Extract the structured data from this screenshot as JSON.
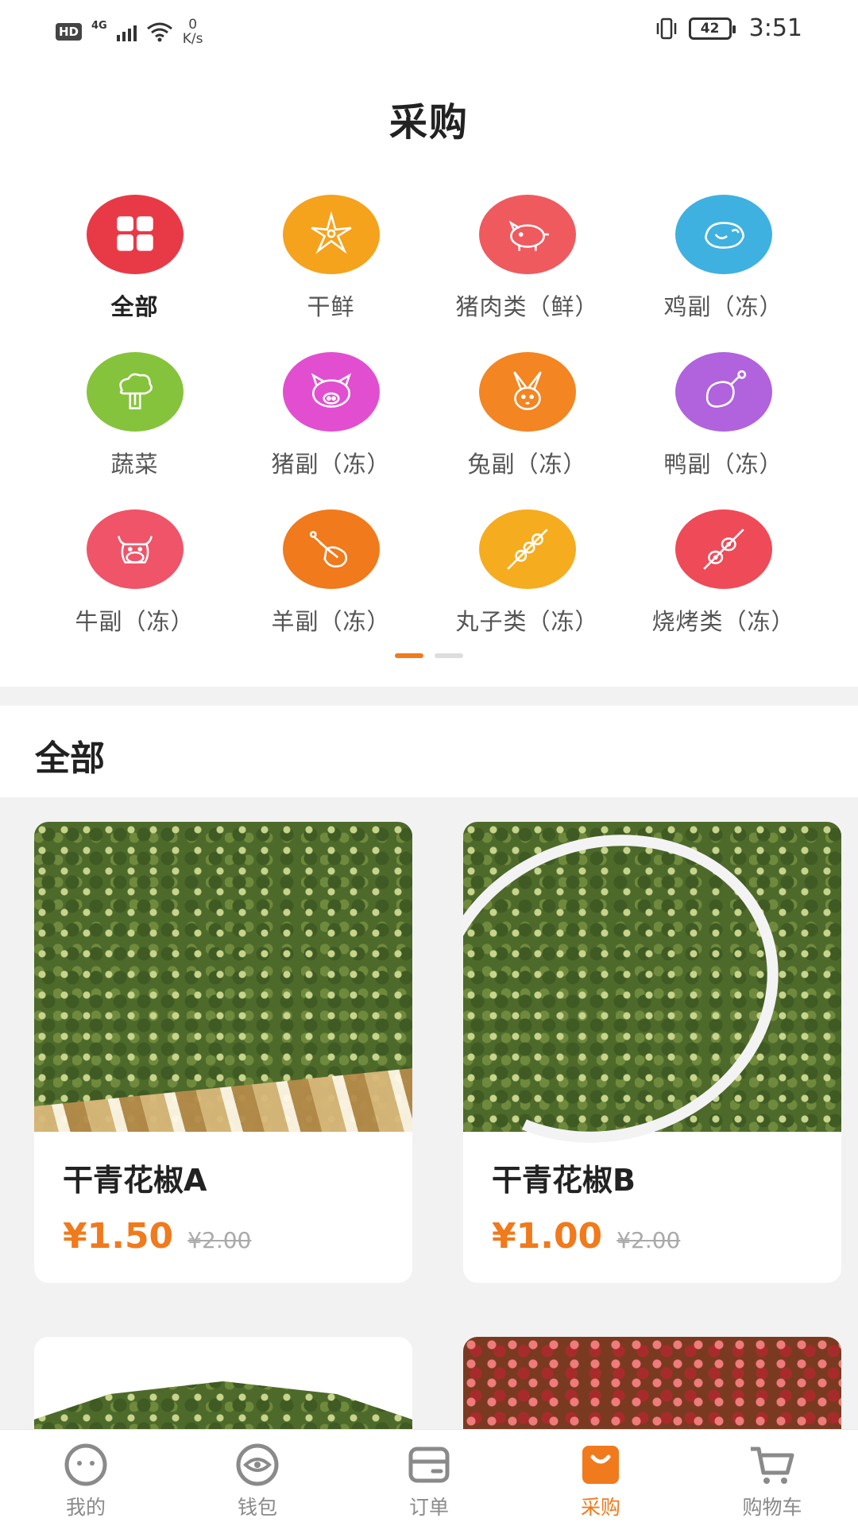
{
  "status_bar": {
    "hd": "HD",
    "network": "4G",
    "speed_value": "0",
    "speed_unit": "K/s",
    "battery": "42",
    "time": "3:51"
  },
  "header": {
    "title": "采购"
  },
  "categories": [
    {
      "label": "全部",
      "icon": "grid-icon",
      "color": "#e83a46"
    },
    {
      "label": "干鲜",
      "icon": "star-anise-icon",
      "color": "#f5a21d"
    },
    {
      "label": "猪肉类（鲜）",
      "icon": "pig-icon",
      "color": "#ef5a5f"
    },
    {
      "label": "鸡副（冻）",
      "icon": "chicken-icon",
      "color": "#3fb1e0"
    },
    {
      "label": "蔬菜",
      "icon": "broccoli-icon",
      "color": "#86c33c"
    },
    {
      "label": "猪副（冻）",
      "icon": "pig-face-icon",
      "color": "#e14fd0"
    },
    {
      "label": "兔副（冻）",
      "icon": "rabbit-icon",
      "color": "#f38522"
    },
    {
      "label": "鸭副（冻）",
      "icon": "drumstick-icon",
      "color": "#b063dd"
    },
    {
      "label": "牛副（冻）",
      "icon": "cow-icon",
      "color": "#ef5468"
    },
    {
      "label": "羊副（冻）",
      "icon": "lamb-chop-icon",
      "color": "#f07a1c"
    },
    {
      "label": "丸子类（冻）",
      "icon": "skewer-icon",
      "color": "#f6ac1f"
    },
    {
      "label": "烧烤类（冻）",
      "icon": "bbq-skewer-icon",
      "color": "#ef4a57"
    }
  ],
  "pager": {
    "pages": 2,
    "current": 1
  },
  "section": {
    "title": "全部"
  },
  "products": [
    {
      "name": "干青花椒A",
      "price": "¥1.50",
      "original_price": "¥2.00"
    },
    {
      "name": "干青花椒B",
      "price": "¥1.00",
      "original_price": "¥2.00"
    },
    {
      "name": "",
      "price": "",
      "original_price": ""
    },
    {
      "name": "",
      "price": "",
      "original_price": ""
    }
  ],
  "bottom_nav": {
    "items": [
      {
        "label": "我的",
        "icon": "face-icon"
      },
      {
        "label": "钱包",
        "icon": "wallet-eye-icon"
      },
      {
        "label": "订单",
        "icon": "order-card-icon"
      },
      {
        "label": "采购",
        "icon": "shopping-bag-icon"
      },
      {
        "label": "购物车",
        "icon": "cart-icon"
      }
    ],
    "active": "采购"
  },
  "colors": {
    "accent": "#f07a1c",
    "price": "#f07a1c"
  }
}
